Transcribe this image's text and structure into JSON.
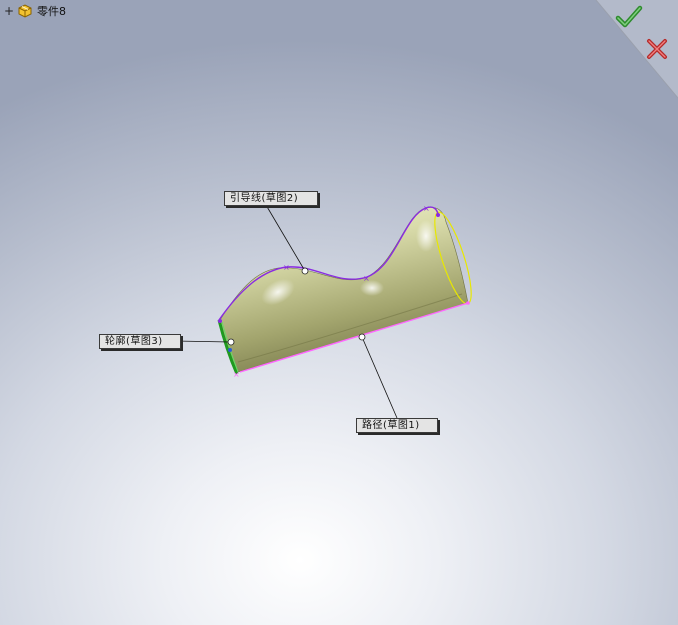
{
  "feature_tree": {
    "expand_symbol": "+",
    "part_name": "零件8",
    "icon": "part-icon"
  },
  "confirm_corner": {
    "ok_icon": "checkmark-icon",
    "cancel_icon": "close-icon",
    "ok_color": "#3a9a3a",
    "cancel_color": "#c83a3a"
  },
  "callouts": {
    "guide_curve": "引导线(草图2)",
    "profile": "轮廓(草图3)",
    "path": "路径(草图1)"
  },
  "colors": {
    "guide_curve": "#8a2be2",
    "path": "#ff66ff",
    "profile": "#22aa22",
    "end_face": "#e8e800",
    "body": "#d8d9a6"
  }
}
